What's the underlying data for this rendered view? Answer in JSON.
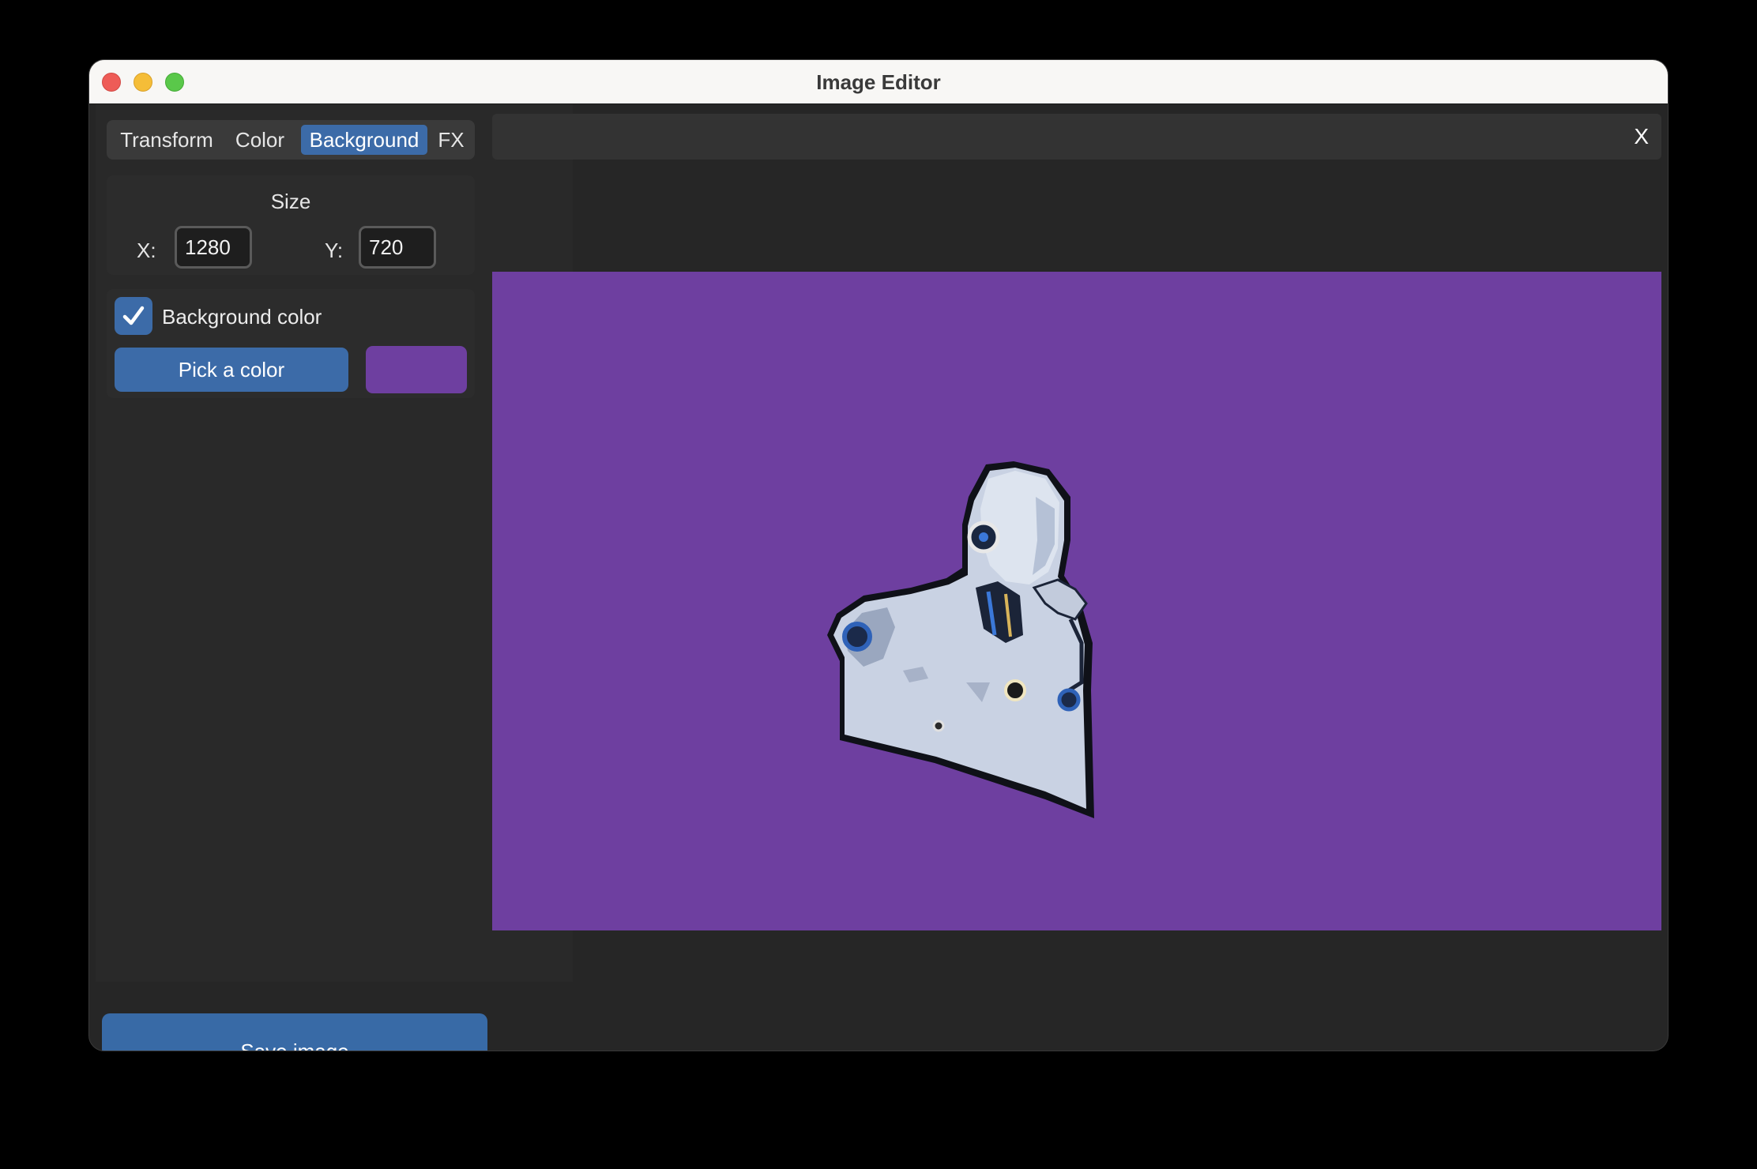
{
  "window": {
    "title": "Image Editor"
  },
  "tabs": [
    {
      "label": "Transform"
    },
    {
      "label": "Color"
    },
    {
      "label": "Background",
      "active": true
    },
    {
      "label": "FX"
    }
  ],
  "size": {
    "title": "Size",
    "x_label": "X:",
    "x_value": "1280",
    "y_label": "Y:",
    "y_value": "720"
  },
  "background": {
    "checkbox_label": "Background color",
    "checked": true,
    "pick_label": "Pick a color",
    "swatch_color": "#6e3fa0"
  },
  "save_label": "Save image",
  "close_label": "X",
  "colors": {
    "accent": "#3c6ba8",
    "canvas_bg": "#6e3fa0",
    "window_bg": "#262626"
  }
}
